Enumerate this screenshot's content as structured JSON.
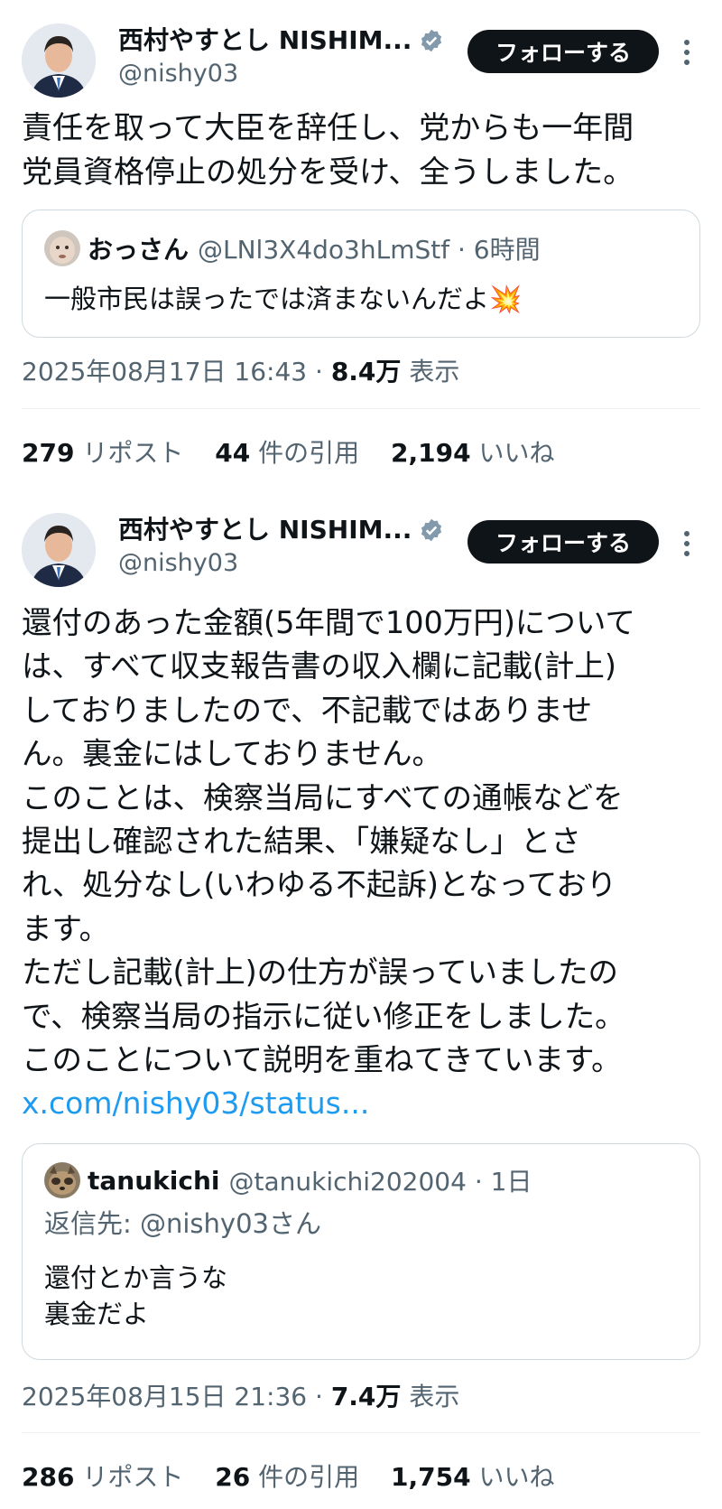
{
  "tweets": [
    {
      "author": {
        "display_name": "西村やすとし NISHIM...",
        "handle": "@nishy03"
      },
      "follow_label": "フォローする",
      "text": "責任を取って大臣を辞任し、党からも一年間\n党員資格停止の処分を受け、全うしました。",
      "quote": {
        "name": "おっさん",
        "handle_time": "@LNl3X4do3hLmStf · 6時間",
        "text": "一般市民は誤ったでは済まないんだよ💥"
      },
      "timestamp": "2025年08月17日 16:43 · ",
      "views": "8.4万",
      "views_label": " 表示",
      "stats": {
        "reposts": "279",
        "reposts_label": " リポスト",
        "quotes": "44",
        "quotes_label": " 件の引用",
        "likes": "2,194",
        "likes_label": " いいね"
      }
    },
    {
      "author": {
        "display_name": "西村やすとし NISHIM...",
        "handle": "@nishy03"
      },
      "follow_label": "フォローする",
      "text_lines": [
        "還付のあった金額(5年間で100万円)について",
        "は、すべて収支報告書の収入欄に記載(計上)",
        "しておりましたので、不記載ではありませ",
        "ん。裏金にはしておりません。",
        "このことは、検察当局にすべての通帳などを",
        "提出し確認された結果、「嫌疑なし」とさ",
        "れ、処分なし(いわゆる不起訴)となっており",
        "ます。",
        "ただし記載(計上)の仕方が誤っていましたの",
        "で、検察当局の指示に従い修正をしました。",
        "このことについて説明を重ねてきています。"
      ],
      "link": "x.com/nishy03/status...",
      "quote": {
        "name": "tanukichi",
        "handle_time": "@tanukichi202004 · 1日",
        "reply_to": "返信先: @nishy03さん",
        "text_lines": [
          "還付とか言うな",
          "裏金だよ"
        ]
      },
      "timestamp": "2025年08月15日 21:36 · ",
      "views": "7.4万",
      "views_label": " 表示",
      "stats": {
        "reposts": "286",
        "reposts_label": " リポスト",
        "quotes": "26",
        "quotes_label": " 件の引用",
        "likes": "1,754",
        "likes_label": " いいね"
      }
    }
  ],
  "colors": {
    "verified": "#829aab",
    "link": "#1d9bf0",
    "muted": "#536471",
    "follow_bg": "#0f1419"
  }
}
